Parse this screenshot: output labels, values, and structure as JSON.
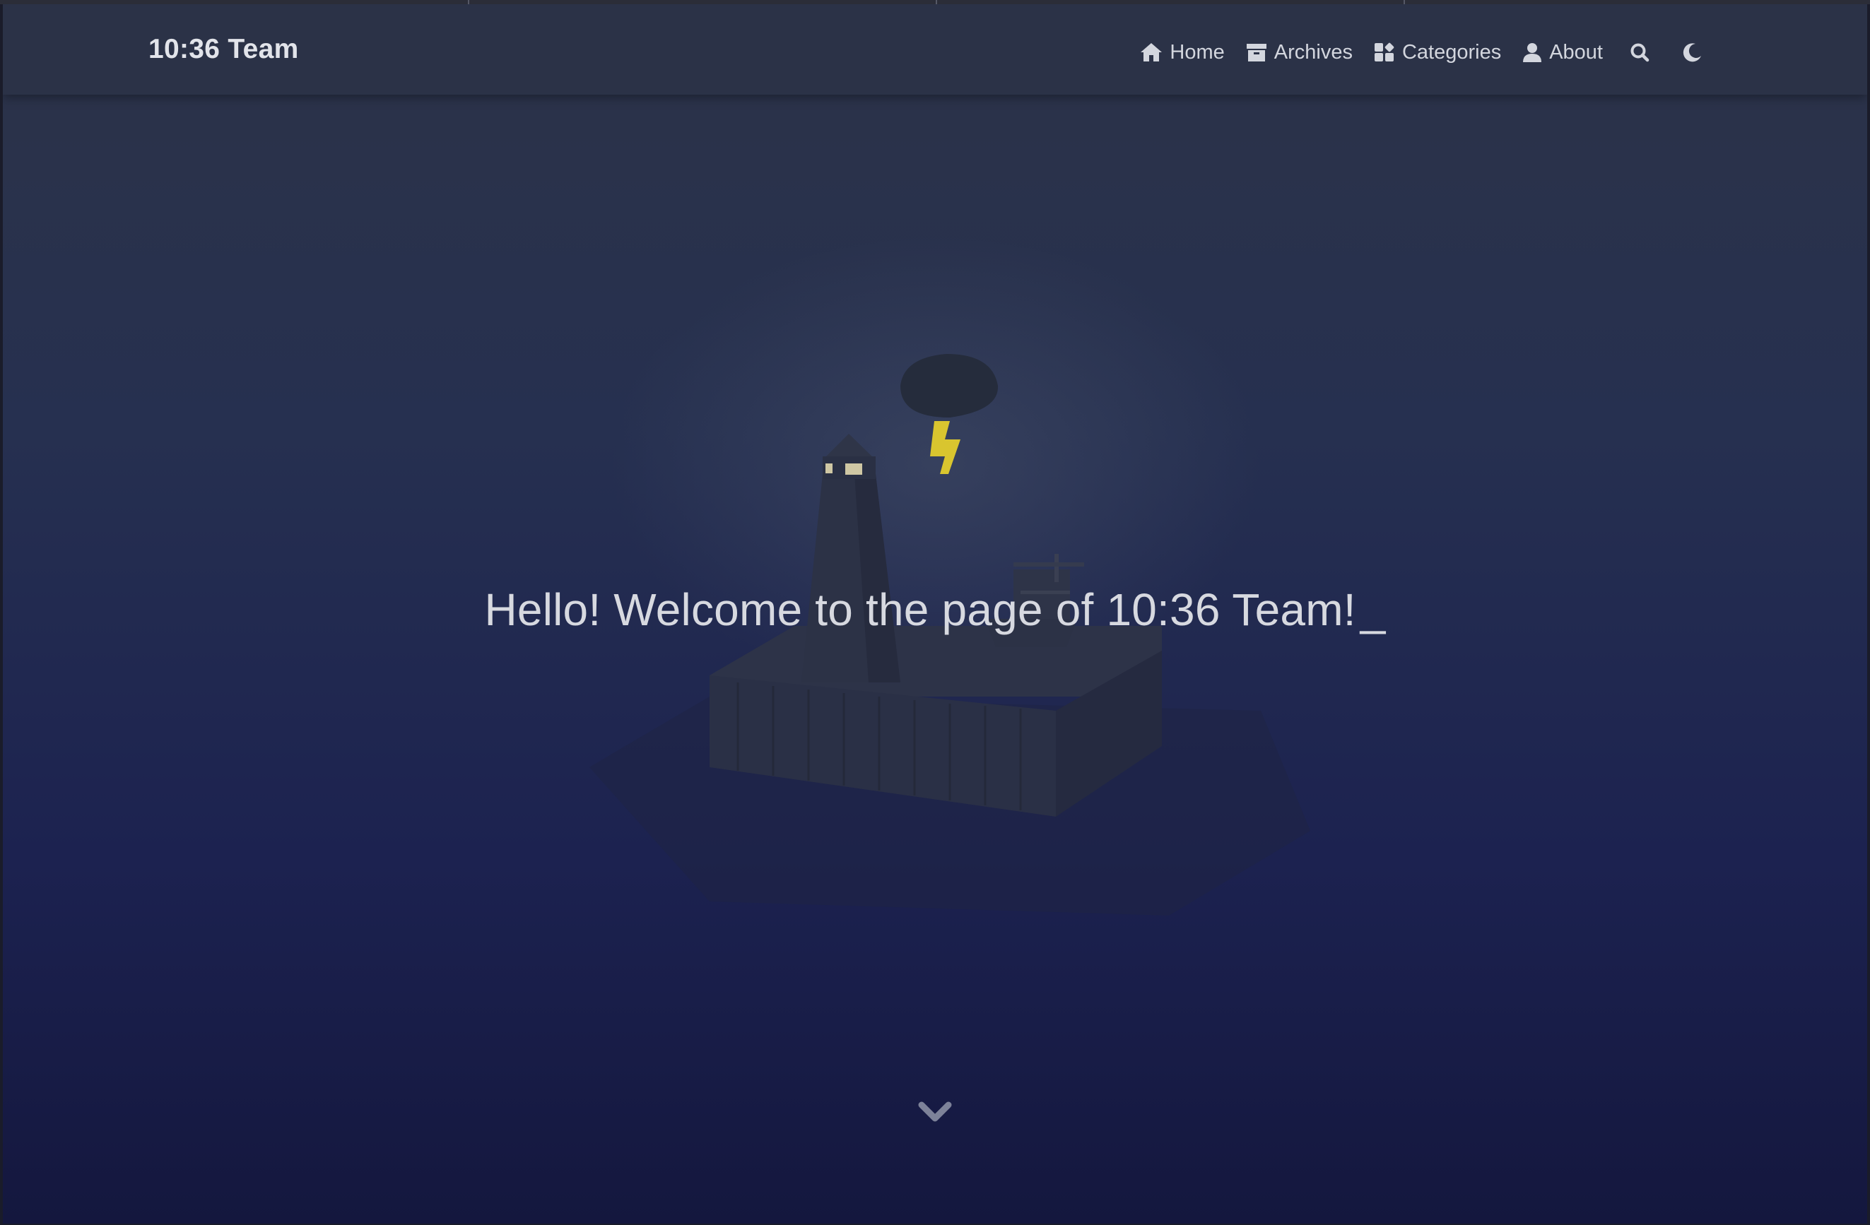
{
  "navbar": {
    "brand": "10:36 Team",
    "items": [
      {
        "label": "Home",
        "icon": "home-icon"
      },
      {
        "label": "Archives",
        "icon": "archive-icon"
      },
      {
        "label": "Categories",
        "icon": "categories-icon"
      },
      {
        "label": "About",
        "icon": "user-icon"
      }
    ],
    "search_icon": "search-icon",
    "theme_icon": "moon-icon"
  },
  "hero": {
    "headline": "Hello! Welcome to the page of 10:36 Team!",
    "cursor": "_",
    "scroll_icon": "chevron-down-icon"
  },
  "colors": {
    "navbar_bg": "#2b3247",
    "text": "#d7d9e0",
    "lightning": "#e6d23a"
  }
}
